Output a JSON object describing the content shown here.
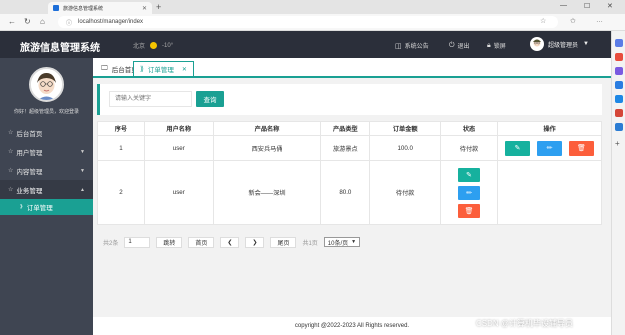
{
  "browser": {
    "tab_title": "旅游信息管理系统",
    "url": "localhost/manager/index",
    "info_icon": "info-icon"
  },
  "header": {
    "brand": "旅游信息管理系统",
    "city": "北京",
    "temperature": "-10°",
    "notice_label": "系统公告",
    "logout_label": "退出",
    "lock_label": "锁屏",
    "user_name": "超级管理员"
  },
  "sidebar": {
    "greeting": "你好！超级管理员，欢迎登录",
    "items": [
      {
        "label": "后台首页",
        "icon": "home-icon",
        "has_arrow": false
      },
      {
        "label": "用户管理",
        "icon": "user-icon",
        "has_arrow": true
      },
      {
        "label": "内容管理",
        "icon": "content-icon",
        "has_arrow": true
      },
      {
        "label": "业务管理",
        "icon": "business-icon",
        "has_arrow": true,
        "expanded": true
      }
    ],
    "sub_item": {
      "label": "订单管理"
    }
  },
  "tabs": [
    {
      "label": "后台首页",
      "active": false
    },
    {
      "label": "订单管理",
      "active": true
    }
  ],
  "search": {
    "placeholder": "请输入关键字",
    "button_label": "查询"
  },
  "table": {
    "headers": [
      "序号",
      "用户名称",
      "产品名称",
      "产品类型",
      "订单金额",
      "状态",
      "操作"
    ],
    "rows": [
      {
        "no": "1",
        "user": "user",
        "product": "西安兵马俑",
        "type": "旅游景点",
        "amount": "100.0",
        "status": "待付款"
      },
      {
        "no": "2",
        "user": "user",
        "product": "新会——深圳",
        "type": "80.0",
        "amount": "待付款",
        "status": ""
      }
    ]
  },
  "pager": {
    "total": "共2条",
    "page_input": "1",
    "jump_label": "跳转",
    "first_label": "首页",
    "prev_icon": "chevron-left-icon",
    "next_icon": "chevron-right-icon",
    "last_label": "尾页",
    "total_pages": "共1页",
    "page_size": "10条/页"
  },
  "footer": {
    "copyright": "copyright @2022-2023 All Rights reserved."
  },
  "watermark": "CSDN @计算机毕设辅导员",
  "colors": {
    "accent": "#1aa093",
    "header_bg": "#2b2f3a",
    "sidebar_bg": "#3f4552",
    "edit_btn": "#16b19e",
    "update_btn": "#2d9ff0",
    "delete_btn": "#fc5e3b"
  }
}
